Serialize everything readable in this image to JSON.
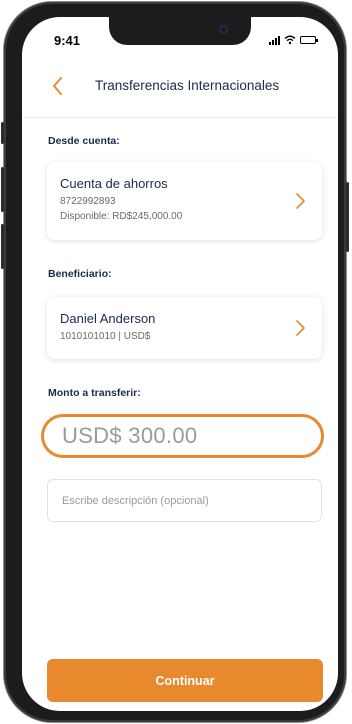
{
  "status_bar": {
    "time": "9:41"
  },
  "header": {
    "title": "Transferencias Internacionales"
  },
  "from_account": {
    "label": "Desde cuenta:",
    "name": "Cuenta de ahorros",
    "number": "8722992893",
    "available": "Disponible: RD$245,000.00"
  },
  "beneficiary": {
    "label": "Beneficiario:",
    "name": "Daniel Anderson",
    "details": "1010101010 | USD$"
  },
  "amount": {
    "label": "Monto a transferir:",
    "value": "USD$ 300.00"
  },
  "description": {
    "placeholder": "Escribe descripción (opcional)"
  },
  "continue_button": {
    "label": "Continuar"
  },
  "colors": {
    "accent": "#e8892e",
    "navy": "#1a2b4c",
    "frame": "#1c1c1e"
  },
  "icons": [
    "back-chevron-icon",
    "chevron-right-icon",
    "signal-icon",
    "wifi-icon",
    "battery-icon"
  ]
}
